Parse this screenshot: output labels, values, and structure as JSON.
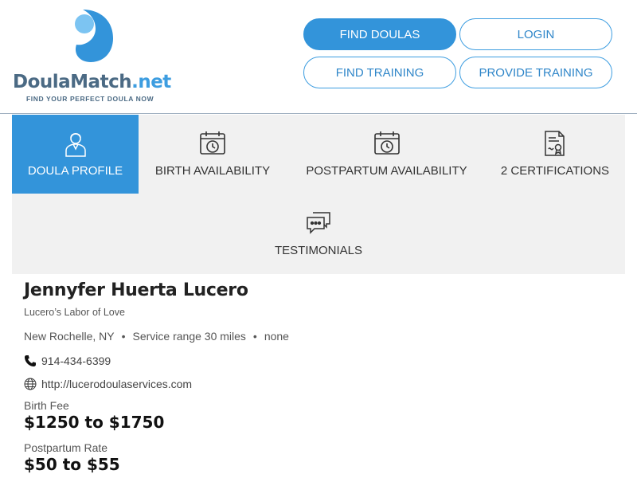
{
  "header": {
    "logo": {
      "brand": "DoulaMatch",
      "tld": ".net",
      "tagline": "FIND YOUR PERFECT DOULA NOW"
    },
    "nav": {
      "find_doulas": "FIND DOULAS",
      "login": "LOGIN",
      "find_training": "FIND TRAINING",
      "provide_training": "PROVIDE TRAINING"
    }
  },
  "tabs": {
    "doula_profile": "DOULA PROFILE",
    "birth_availability": "BIRTH AVAILABILITY",
    "postpartum_availability": "POSTPARTUM AVAILABILITY",
    "certifications": "2 CERTIFICATIONS",
    "testimonials": "TESTIMONIALS"
  },
  "profile": {
    "name": "Jennyfer Huerta Lucero",
    "business": "Lucero’s Labor of Love",
    "location": "New Rochelle, NY",
    "service_range": "Service range 30 miles",
    "extra": "none",
    "separator": "•",
    "phone": "914-434-6399",
    "website": "http://lucerodoulaservices.com",
    "birth_fee_label": "Birth Fee",
    "birth_fee_value": "$1250 to $1750",
    "postpartum_rate_label": "Postpartum Rate",
    "postpartum_rate_value": "$50 to $55"
  },
  "icons": {
    "logo": "doulamatch-logo-mark",
    "doula_profile": "doula-person-icon",
    "birth_availability": "calendar-clock-icon",
    "postpartum_availability": "calendar-clock-icon",
    "certifications": "certificate-icon",
    "testimonials": "chat-bubbles-icon",
    "phone": "phone-icon",
    "website": "globe-icon"
  },
  "colors": {
    "accent": "#3394da",
    "brand_text": "#4b6a84",
    "tab_background": "#f1f1f1"
  }
}
